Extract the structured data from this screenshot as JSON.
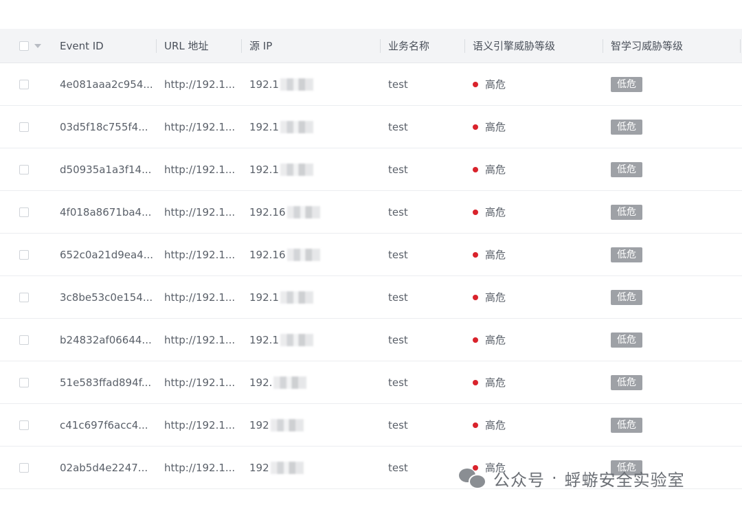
{
  "colors": {
    "danger_dot": "#d9232c",
    "low_badge_bg": "#9ea1a6",
    "header_bg": "#f3f4f6"
  },
  "table": {
    "headers": {
      "event_id": "Event ID",
      "url": "URL 地址",
      "source_ip": "源 IP",
      "business_name": "业务名称",
      "semantic_threat": "语义引擎威胁等级",
      "intel_threat": "智学习威胁等级"
    },
    "rows": [
      {
        "event_id": "4e081aaa2c954...",
        "url": "http://192.1...",
        "ip": "192.1",
        "business": "test",
        "semantic": "高危",
        "intel": "低危"
      },
      {
        "event_id": "03d5f18c755f4...",
        "url": "http://192.1...",
        "ip": "192.1",
        "business": "test",
        "semantic": "高危",
        "intel": "低危"
      },
      {
        "event_id": "d50935a1a3f14...",
        "url": "http://192.1...",
        "ip": "192.1",
        "business": "test",
        "semantic": "高危",
        "intel": "低危"
      },
      {
        "event_id": "4f018a8671ba4...",
        "url": "http://192.1...",
        "ip": "192.16",
        "business": "test",
        "semantic": "高危",
        "intel": "低危"
      },
      {
        "event_id": "652c0a21d9ea4...",
        "url": "http://192.1...",
        "ip": "192.16",
        "business": "test",
        "semantic": "高危",
        "intel": "低危"
      },
      {
        "event_id": "3c8be53c0e154...",
        "url": "http://192.1...",
        "ip": "192.1",
        "business": "test",
        "semantic": "高危",
        "intel": "低危"
      },
      {
        "event_id": "b24832af06644...",
        "url": "http://192.1...",
        "ip": "192.1",
        "business": "test",
        "semantic": "高危",
        "intel": "低危"
      },
      {
        "event_id": "51e583ffad894f...",
        "url": "http://192.1...",
        "ip": "192.",
        "business": "test",
        "semantic": "高危",
        "intel": "低危"
      },
      {
        "event_id": "c41c697f6acc4...",
        "url": "http://192.1...",
        "ip": "192",
        "business": "test",
        "semantic": "高危",
        "intel": "低危"
      },
      {
        "event_id": "02ab5d4e2247...",
        "url": "http://192.1...",
        "ip": "192",
        "business": "test",
        "semantic": "高危",
        "intel": "低危"
      }
    ]
  },
  "watermark": {
    "left": "公众号",
    "separator": "·",
    "right": "蜉蝣安全实验室"
  }
}
